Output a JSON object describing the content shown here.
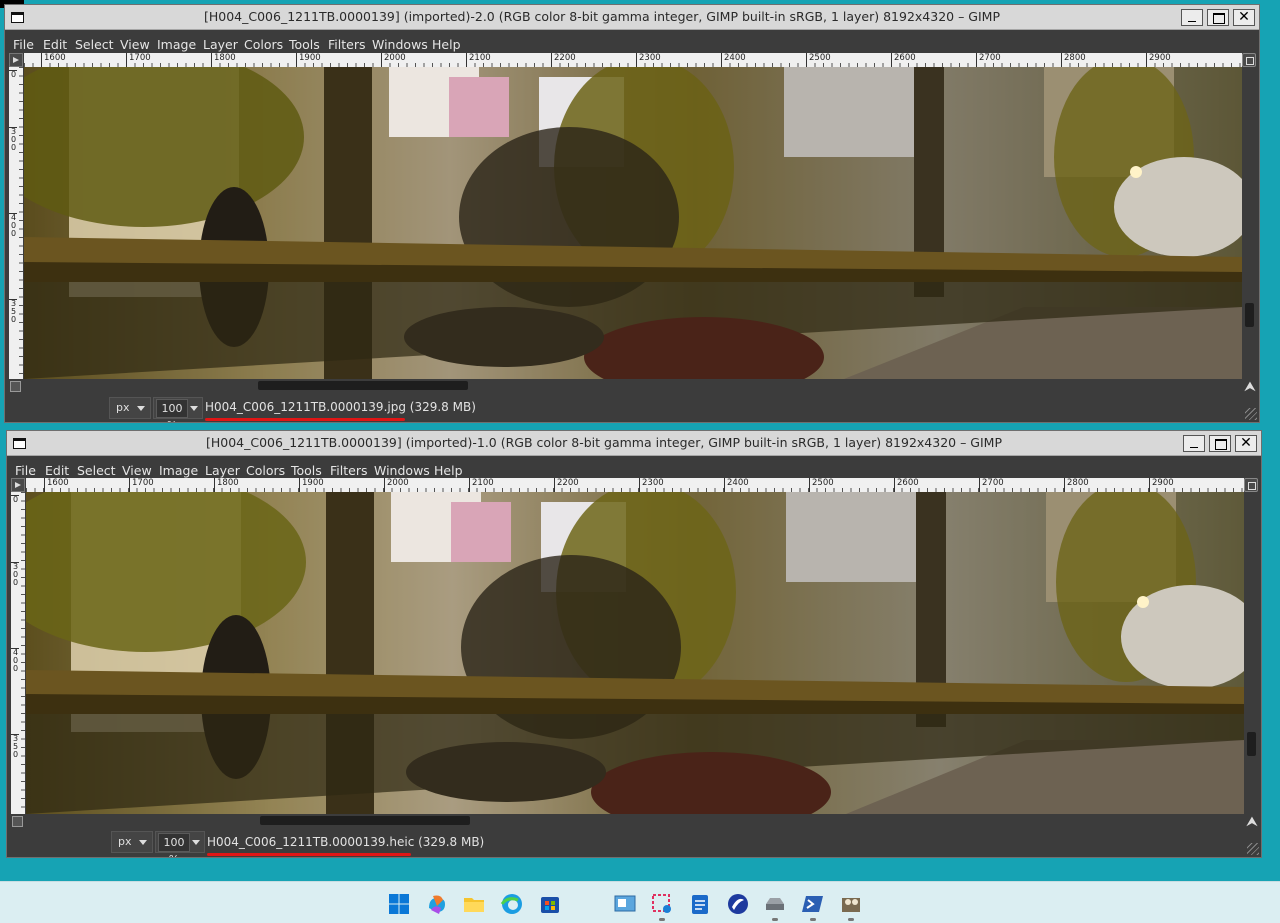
{
  "menu": [
    "File",
    "Edit",
    "Select",
    "View",
    "Image",
    "Layer",
    "Colors",
    "Tools",
    "Filters",
    "Windows",
    "Help"
  ],
  "ruler_ticks": [
    "1600",
    "1700",
    "1800",
    "1900",
    "2000",
    "2100",
    "2200",
    "2300",
    "2400",
    "2500",
    "2600",
    "2700",
    "2800",
    "2900"
  ],
  "vruler_ticks": [
    "0",
    "300",
    "400",
    "350"
  ],
  "windows": [
    {
      "title": "[H004_C006_1211TB.0000139] (imported)-2.0 (RGB color 8-bit gamma integer, GIMP built-in sRGB, 1 layer) 8192x4320 – GIMP",
      "unit": "px",
      "zoom": "100 %",
      "status": "H004_C006_1211TB.0000139.jpg (329.8 MB)"
    },
    {
      "title": "[H004_C006_1211TB.0000139] (imported)-1.0 (RGB color 8-bit gamma integer, GIMP built-in sRGB, 1 layer) 8192x4320 – GIMP",
      "unit": "px",
      "zoom": "100 %",
      "status": "H004_C006_1211TB.0000139.heic (329.8 MB)"
    }
  ],
  "window_buttons": {
    "close": "✕"
  },
  "colors": {
    "desktop": "#16a3b4",
    "underline": "#e01515",
    "gimp_bg": "#3c3c3c"
  },
  "taskbar_icons": [
    "windows-start-icon",
    "copilot-icon",
    "file-explorer-icon",
    "edge-icon",
    "store-icon",
    "control-panel-icon",
    "snipping-tool-icon",
    "notepad-icon",
    "app-icon",
    "drive-icon",
    "powershell-icon",
    "gimp-icon"
  ]
}
